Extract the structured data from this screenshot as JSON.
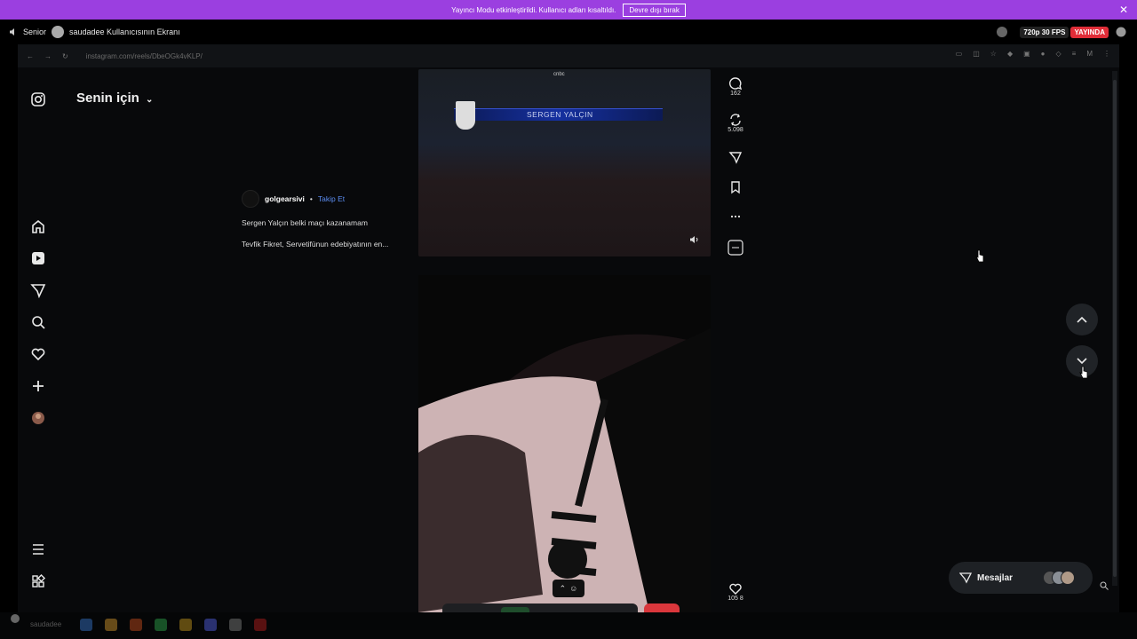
{
  "banner": {
    "message": "Yayıncı Modu etkinleştirildi. Kullanıcı adları kısaltıldı.",
    "button_label": "Devre dışı bırak",
    "close_glyph": "✕"
  },
  "stream_header": {
    "channel": "Senior",
    "streamer_title": "saudadee Kullanıcısının Ekranı",
    "quality": "720p 30 FPS",
    "live_label": "YAYINDA"
  },
  "browser": {
    "url": "instagram.com/reels/DbeOGk4vKLP/"
  },
  "instagram": {
    "feed_title": "Senin için",
    "sidebar_icons": [
      "instagram-icon",
      "home-icon",
      "reels-icon",
      "direct-icon",
      "search-icon",
      "heart-icon",
      "plus-icon",
      "profile-avatar",
      "menu-icon",
      "grid-icon"
    ],
    "reel": {
      "username": "golgearsivi",
      "separator": "•",
      "follow_label": "Takip Et",
      "caption_line1": "Sergen Yalçın belki maçı kazanamam",
      "caption_line2": "Tevfik Fikret, Servetifünun edebiyatının en...",
      "lower_third": "SERGEN YALÇIN",
      "video_top_label": "cnbc"
    },
    "actions": {
      "comments": "162",
      "reposts": "5.098",
      "next_likes": "105 8"
    },
    "messages_label": "Mesajlar"
  },
  "taskbar": {
    "user": "saudadee"
  },
  "colors": {
    "banner": "#9b3fe0",
    "live": "#e02d38",
    "follow": "#5b8cf0",
    "end_call": "#da373c"
  }
}
